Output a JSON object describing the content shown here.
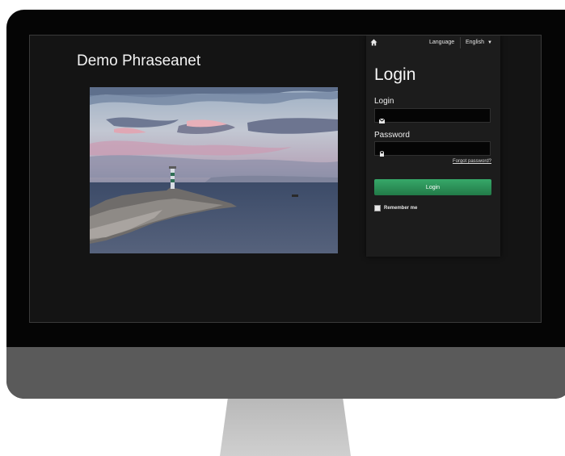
{
  "site": {
    "title": "Demo Phraseanet"
  },
  "topbar": {
    "language_label": "Language",
    "language_value": "English"
  },
  "login": {
    "heading": "Login",
    "login_label": "Login",
    "login_value": "",
    "password_label": "Password",
    "password_value": "",
    "forgot_label": "Forgot password?",
    "submit_label": "Login",
    "remember_label": "Remember me",
    "remember_checked": false
  },
  "icons": {
    "home": "home-icon",
    "email": "envelope-icon",
    "password": "lock-icon",
    "dropdown": "caret-down-icon"
  },
  "colors": {
    "accent": "#2f9a5d",
    "panel_bg": "#1c1c1c",
    "screen_bg": "#141414"
  }
}
